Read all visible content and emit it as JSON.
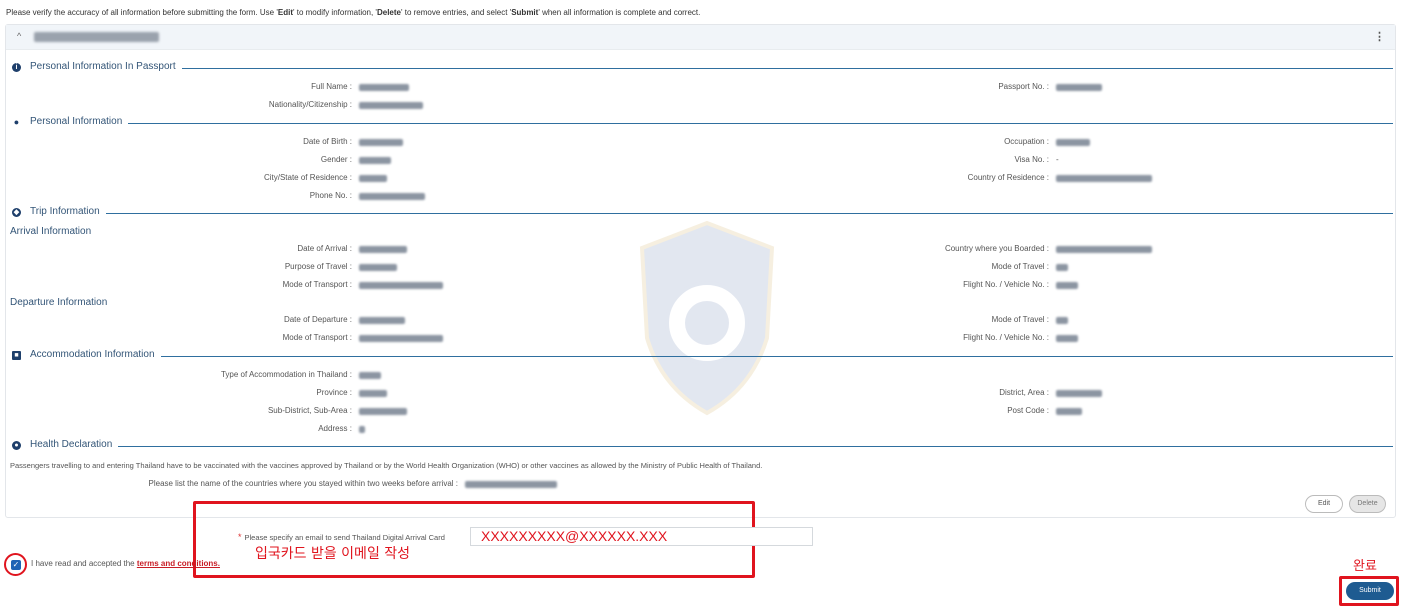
{
  "notice": {
    "prefix": "Please verify the accuracy of all information before submitting the form. Use '",
    "edit_word": "Edit",
    "mid1": "' to modify information, '",
    "delete_word": "Delete",
    "mid2": "' to remove entries, and select '",
    "submit_word": "Submit",
    "suffix": "' when all information is complete and correct."
  },
  "card": {
    "collapse_icon": "chevron-up-icon",
    "menu_icon": "kebab-menu-icon"
  },
  "sections": {
    "passport": "Personal Information In Passport",
    "personal": "Personal Information",
    "trip": "Trip Information",
    "accommodation": "Accommodation Information",
    "health": "Health Declaration"
  },
  "subheads": {
    "arrival": "Arrival Information",
    "departure": "Departure Information"
  },
  "labels": {
    "full_name": "Full Name :",
    "passport_no": "Passport No. :",
    "nationality": "Nationality/Citizenship :",
    "dob": "Date of Birth :",
    "occupation": "Occupation :",
    "gender": "Gender :",
    "visa_no": "Visa No. :",
    "city": "City/State of Residence :",
    "country_res": "Country of Residence :",
    "phone": "Phone No. :",
    "date_arrival": "Date of Arrival :",
    "country_boarded": "Country where you Boarded :",
    "purpose": "Purpose of Travel :",
    "mode_travel": "Mode of Travel :",
    "mode_transport": "Mode of Transport :",
    "flight_no": "Flight No. / Vehicle No. :",
    "date_departure": "Date of Departure :",
    "accom_type": "Type of Accommodation in Thailand :",
    "province": "Province :",
    "district": "District, Area :",
    "subdistrict": "Sub-District, Sub-Area :",
    "postcode": "Post Code :",
    "address": "Address :",
    "countries_stayed": "Please list the name of the countries where you stayed within two weeks before arrival :"
  },
  "values": {
    "visa_no": "-"
  },
  "health_text": "Passengers travelling to and entering Thailand have to be vaccinated with the vaccines approved by Thailand or by the World Health Organization (WHO) or other vaccines as allowed by the Ministry of Public Health of Thailand.",
  "buttons": {
    "edit": "Edit",
    "delete": "Delete",
    "submit": "Submit"
  },
  "email": {
    "required_mark": "*",
    "label": "Please specify an email to send Thailand Digital Arrival Card",
    "value": "XXXXXXXXX@XXXXXX.XXX"
  },
  "terms": {
    "prefix": "I have read and accepted the ",
    "link": "terms and conditions."
  },
  "annotations": {
    "email_note": "입국카드 받을 이메일 작성",
    "done_note": "완료"
  },
  "colors": {
    "accent": "#1e5b91",
    "annotation_red": "#e0141e",
    "section_line": "#2f6f9f"
  }
}
